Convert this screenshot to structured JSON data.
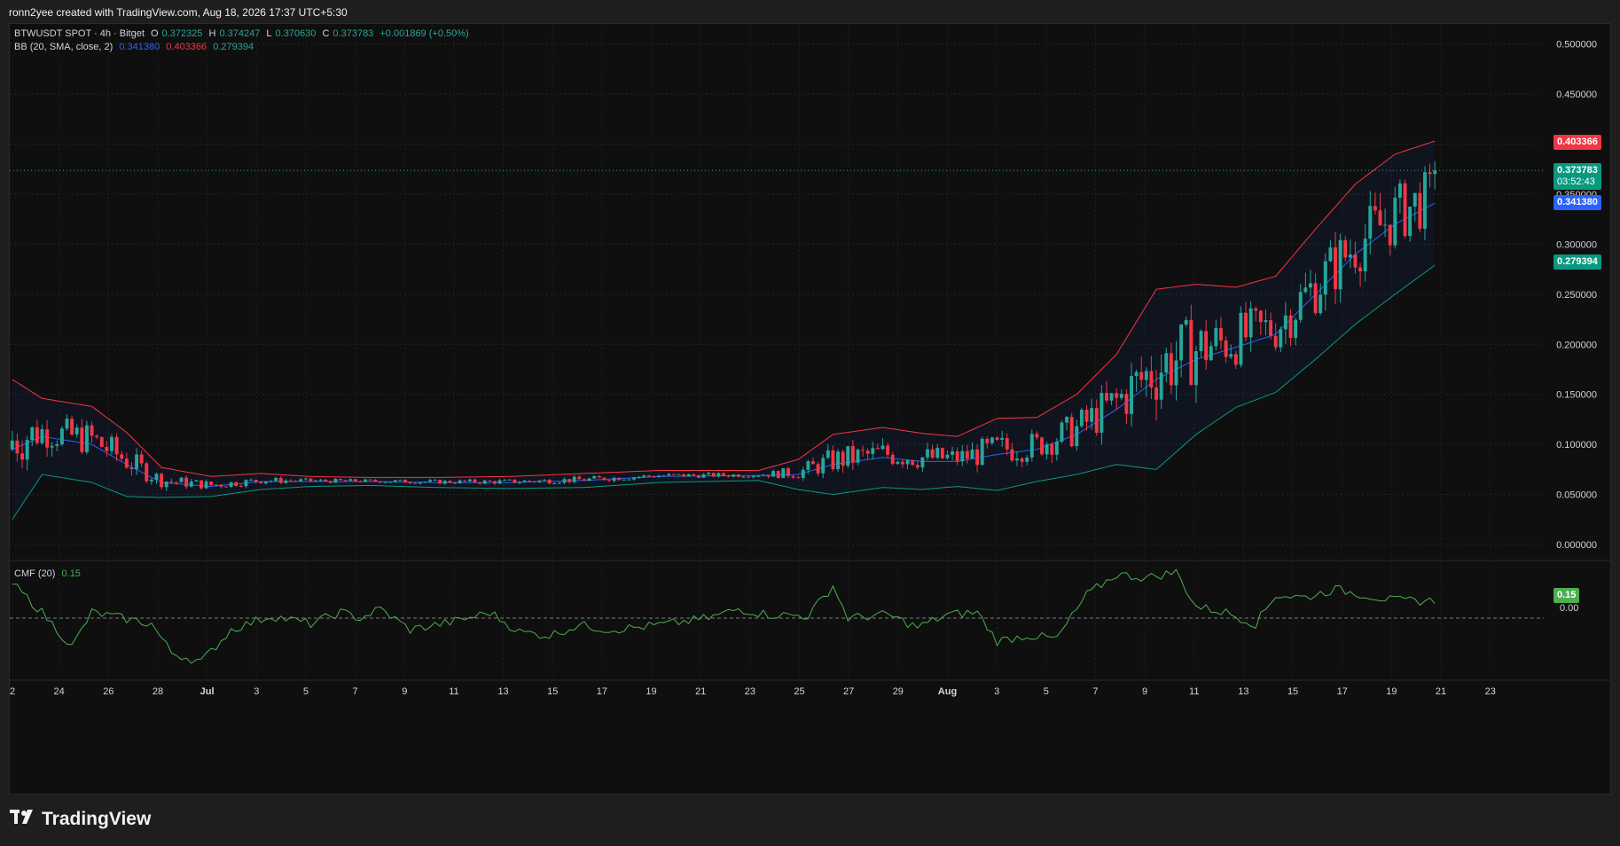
{
  "header": {
    "text": "ronn2yee created with TradingView.com, Aug 18, 2026 17:37 UTC+5:30"
  },
  "symbol": {
    "name": "BTWUSDT SPOT · 4h · Bitget",
    "o_label": "O",
    "o": "0.372325",
    "h_label": "H",
    "h": "0.374247",
    "l_label": "L",
    "l": "0.370630",
    "c_label": "C",
    "c": "0.373783",
    "change": "+0.001869 (+0.50%)"
  },
  "bb_legend": {
    "label": "BB (20, SMA, close, 2)",
    "basis": "0.341380",
    "upper": "0.403366",
    "lower": "0.279394"
  },
  "cmf_legend": {
    "label": "CMF (20)",
    "value": "0.15"
  },
  "price_tags": {
    "upper": "0.403366",
    "last": "0.373783",
    "countdown": "03:52:43",
    "basis": "0.341380",
    "lower": "0.279394",
    "cmf": "0.15",
    "cmf_zero": "0.00"
  },
  "colors": {
    "up": "#26a69a",
    "down": "#f23645",
    "basis": "#2962ff",
    "upper": "#f23645",
    "lower": "#089981",
    "cmf": "#4caf50",
    "bg": "#0f0f0f"
  },
  "footer": {
    "brand": "TradingView",
    "logo_icon": "tradingview-logo-icon"
  },
  "chart_data": [
    {
      "type": "candlestick",
      "title": "BTWUSDT SPOT · 4h · Bitget",
      "y_ticks": [
        "0.500000",
        "0.450000",
        "0.400000",
        "0.350000",
        "0.300000",
        "0.250000",
        "0.200000",
        "0.150000",
        "0.100000",
        "0.050000",
        "0.000000"
      ],
      "ylim": [
        -0.015,
        0.52
      ],
      "x_ticks": [
        "22",
        "24",
        "26",
        "28",
        "Jul",
        "3",
        "5",
        "7",
        "9",
        "11",
        "13",
        "15",
        "17",
        "19",
        "21",
        "23",
        "25",
        "27",
        "29",
        "Aug",
        "3",
        "5",
        "7",
        "9",
        "11",
        "13",
        "15",
        "17",
        "19",
        "21",
        "23"
      ],
      "last_close": 0.373783,
      "grid": true,
      "bollinger": {
        "period": 20,
        "basis_anchor": [
          [
            0,
            0.095
          ],
          [
            6,
            0.108
          ],
          [
            16,
            0.1
          ],
          [
            23,
            0.08
          ],
          [
            30,
            0.062
          ],
          [
            40,
            0.058
          ],
          [
            50,
            0.063
          ],
          [
            60,
            0.063
          ],
          [
            72,
            0.063
          ],
          [
            85,
            0.062
          ],
          [
            100,
            0.062
          ],
          [
            115,
            0.064
          ],
          [
            130,
            0.068
          ],
          [
            150,
            0.069
          ],
          [
            158,
            0.07
          ],
          [
            165,
            0.08
          ],
          [
            175,
            0.087
          ],
          [
            183,
            0.083
          ],
          [
            190,
            0.083
          ],
          [
            198,
            0.09
          ],
          [
            206,
            0.095
          ],
          [
            214,
            0.11
          ],
          [
            222,
            0.135
          ],
          [
            230,
            0.165
          ],
          [
            238,
            0.185
          ],
          [
            246,
            0.197
          ],
          [
            254,
            0.21
          ],
          [
            262,
            0.25
          ],
          [
            270,
            0.29
          ],
          [
            278,
            0.32
          ],
          [
            286,
            0.341
          ]
        ],
        "width_anchor": [
          [
            0,
            0.07
          ],
          [
            6,
            0.038
          ],
          [
            16,
            0.038
          ],
          [
            23,
            0.032
          ],
          [
            30,
            0.015
          ],
          [
            40,
            0.01
          ],
          [
            50,
            0.008
          ],
          [
            60,
            0.005
          ],
          [
            72,
            0.004
          ],
          [
            85,
            0.005
          ],
          [
            100,
            0.006
          ],
          [
            115,
            0.007
          ],
          [
            130,
            0.006
          ],
          [
            150,
            0.005
          ],
          [
            158,
            0.015
          ],
          [
            165,
            0.03
          ],
          [
            175,
            0.03
          ],
          [
            183,
            0.028
          ],
          [
            190,
            0.025
          ],
          [
            198,
            0.036
          ],
          [
            206,
            0.032
          ],
          [
            214,
            0.04
          ],
          [
            222,
            0.055
          ],
          [
            230,
            0.09
          ],
          [
            238,
            0.075
          ],
          [
            246,
            0.06
          ],
          [
            254,
            0.058
          ],
          [
            262,
            0.065
          ],
          [
            270,
            0.07
          ],
          [
            278,
            0.07
          ],
          [
            286,
            0.062
          ]
        ]
      },
      "candle_count": 287
    },
    {
      "type": "line",
      "title": "CMF (20)",
      "last_value": 0.15,
      "ylim": [
        -0.4,
        0.4
      ],
      "zero_line": true,
      "cmf_anchor": [
        [
          0,
          0.3
        ],
        [
          6,
          0.05
        ],
        [
          12,
          -0.25
        ],
        [
          16,
          0.05
        ],
        [
          22,
          0.0
        ],
        [
          28,
          -0.05
        ],
        [
          32,
          -0.3
        ],
        [
          38,
          -0.38
        ],
        [
          44,
          -0.1
        ],
        [
          52,
          0.02
        ],
        [
          60,
          -0.05
        ],
        [
          66,
          0.05
        ],
        [
          70,
          0.0
        ],
        [
          74,
          0.08
        ],
        [
          80,
          -0.1
        ],
        [
          90,
          -0.02
        ],
        [
          96,
          0.05
        ],
        [
          102,
          -0.12
        ],
        [
          108,
          -0.15
        ],
        [
          114,
          -0.06
        ],
        [
          120,
          -0.1
        ],
        [
          126,
          -0.08
        ],
        [
          132,
          -0.05
        ],
        [
          140,
          0.0
        ],
        [
          146,
          0.08
        ],
        [
          152,
          0.03
        ],
        [
          160,
          0.02
        ],
        [
          165,
          0.28
        ],
        [
          168,
          0.0
        ],
        [
          176,
          0.03
        ],
        [
          182,
          -0.08
        ],
        [
          188,
          0.03
        ],
        [
          194,
          0.05
        ],
        [
          198,
          -0.2
        ],
        [
          204,
          -0.15
        ],
        [
          210,
          -0.18
        ],
        [
          216,
          0.2
        ],
        [
          222,
          0.38
        ],
        [
          228,
          0.35
        ],
        [
          234,
          0.4
        ],
        [
          238,
          0.1
        ],
        [
          244,
          0.05
        ],
        [
          250,
          -0.05
        ],
        [
          254,
          0.2
        ],
        [
          260,
          0.18
        ],
        [
          266,
          0.25
        ],
        [
          272,
          0.2
        ],
        [
          278,
          0.15
        ],
        [
          286,
          0.15
        ]
      ]
    }
  ]
}
